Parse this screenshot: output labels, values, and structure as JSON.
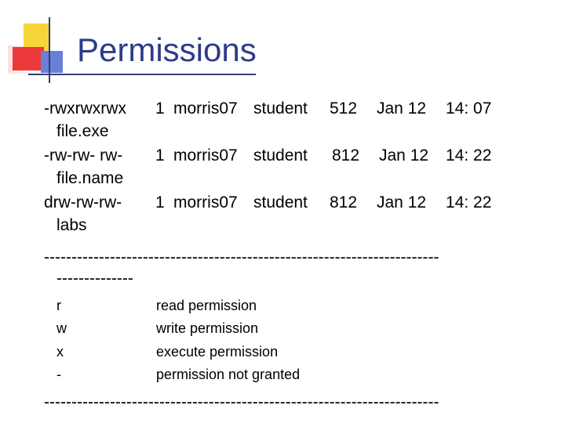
{
  "title": "Permissions",
  "listing": [
    {
      "perm": "-rwxrwxrwx",
      "links": "1",
      "owner": "morris07",
      "group": "student",
      "size": "512",
      "date": "Jan 12",
      "time": "14: 07",
      "name": "file.exe"
    },
    {
      "perm": "-rw-rw- rw-",
      "links": "1",
      "owner": "morris07",
      "group": "student",
      "size": "812",
      "date": "Jan 12",
      "time": "14: 22",
      "name": "file.name"
    },
    {
      "perm": "drw-rw-rw-",
      "links": "1",
      "owner": "morris07",
      "group": "student",
      "size": "812",
      "date": "Jan 12",
      "time": "14: 22",
      "name": "labs"
    }
  ],
  "divider_top_line1": "------------------------------------------------------------------------",
  "divider_top_line2": "--------------",
  "legend": [
    {
      "symbol": "r",
      "meaning": "read permission"
    },
    {
      "symbol": "w",
      "meaning": "write permission"
    },
    {
      "symbol": "x",
      "meaning": "execute permission"
    },
    {
      "symbol": "-",
      "meaning": "permission not granted"
    }
  ],
  "divider_bottom": "------------------------------------------------------------------------"
}
